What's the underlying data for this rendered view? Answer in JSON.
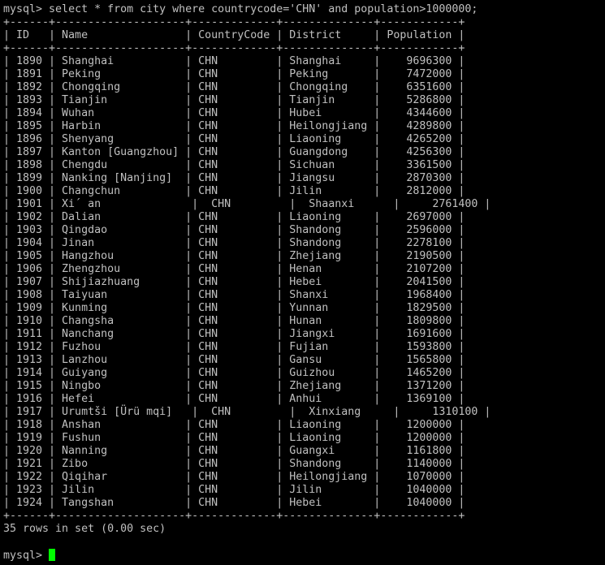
{
  "terminal": {
    "prompt": "mysql> ",
    "command": "select * from city where countrycode='CHN' and population>1000000;",
    "summary": "35 rows in set (0.00 sec)",
    "cursor_color": "#00ff00",
    "text_color": "#c0c0c0",
    "background_color": "#000000"
  },
  "result_table": {
    "columns": [
      "ID",
      "Name",
      "CountryCode",
      "District",
      "Population"
    ],
    "rows": [
      [
        "1890",
        "Shanghai",
        "CHN",
        "Shanghai",
        "9696300"
      ],
      [
        "1891",
        "Peking",
        "CHN",
        "Peking",
        "7472000"
      ],
      [
        "1892",
        "Chongqing",
        "CHN",
        "Chongqing",
        "6351600"
      ],
      [
        "1893",
        "Tianjin",
        "CHN",
        "Tianjin",
        "5286800"
      ],
      [
        "1894",
        "Wuhan",
        "CHN",
        "Hubei",
        "4344600"
      ],
      [
        "1895",
        "Harbin",
        "CHN",
        "Heilongjiang",
        "4289800"
      ],
      [
        "1896",
        "Shenyang",
        "CHN",
        "Liaoning",
        "4265200"
      ],
      [
        "1897",
        "Kanton [Guangzhou]",
        "CHN",
        "Guangdong",
        "4256300"
      ],
      [
        "1898",
        "Chengdu",
        "CHN",
        "Sichuan",
        "3361500"
      ],
      [
        "1899",
        "Nanking [Nanjing]",
        "CHN",
        "Jiangsu",
        "2870300"
      ],
      [
        "1900",
        "Changchun",
        "CHN",
        "Jilin",
        "2812000"
      ],
      [
        "1901",
        "Xi´ an",
        "CHN",
        "Shaanxi",
        "2761400"
      ],
      [
        "1902",
        "Dalian",
        "CHN",
        "Liaoning",
        "2697000"
      ],
      [
        "1903",
        "Qingdao",
        "CHN",
        "Shandong",
        "2596000"
      ],
      [
        "1904",
        "Jinan",
        "CHN",
        "Shandong",
        "2278100"
      ],
      [
        "1905",
        "Hangzhou",
        "CHN",
        "Zhejiang",
        "2190500"
      ],
      [
        "1906",
        "Zhengzhou",
        "CHN",
        "Henan",
        "2107200"
      ],
      [
        "1907",
        "Shijiazhuang",
        "CHN",
        "Hebei",
        "2041500"
      ],
      [
        "1908",
        "Taiyuan",
        "CHN",
        "Shanxi",
        "1968400"
      ],
      [
        "1909",
        "Kunming",
        "CHN",
        "Yunnan",
        "1829500"
      ],
      [
        "1910",
        "Changsha",
        "CHN",
        "Hunan",
        "1809800"
      ],
      [
        "1911",
        "Nanchang",
        "CHN",
        "Jiangxi",
        "1691600"
      ],
      [
        "1912",
        "Fuzhou",
        "CHN",
        "Fujian",
        "1593800"
      ],
      [
        "1913",
        "Lanzhou",
        "CHN",
        "Gansu",
        "1565800"
      ],
      [
        "1914",
        "Guiyang",
        "CHN",
        "Guizhou",
        "1465200"
      ],
      [
        "1915",
        "Ningbo",
        "CHN",
        "Zhejiang",
        "1371200"
      ],
      [
        "1916",
        "Hefei",
        "CHN",
        "Anhui",
        "1369100"
      ],
      [
        "1917",
        "Urumtši [Ürü mqi]",
        "CHN",
        "Xinxiang",
        "1310100"
      ],
      [
        "1918",
        "Anshan",
        "CHN",
        "Liaoning",
        "1200000"
      ],
      [
        "1919",
        "Fushun",
        "CHN",
        "Liaoning",
        "1200000"
      ],
      [
        "1920",
        "Nanning",
        "CHN",
        "Guangxi",
        "1161800"
      ],
      [
        "1921",
        "Zibo",
        "CHN",
        "Shandong",
        "1140000"
      ],
      [
        "1922",
        "Qiqihar",
        "CHN",
        "Heilongjiang",
        "1070000"
      ],
      [
        "1923",
        "Jilin",
        "CHN",
        "Jilin",
        "1040000"
      ],
      [
        "1924",
        "Tangshan",
        "CHN",
        "Hebei",
        "1040000"
      ]
    ],
    "misaligned_rows": [
      "1901",
      "1917"
    ]
  }
}
